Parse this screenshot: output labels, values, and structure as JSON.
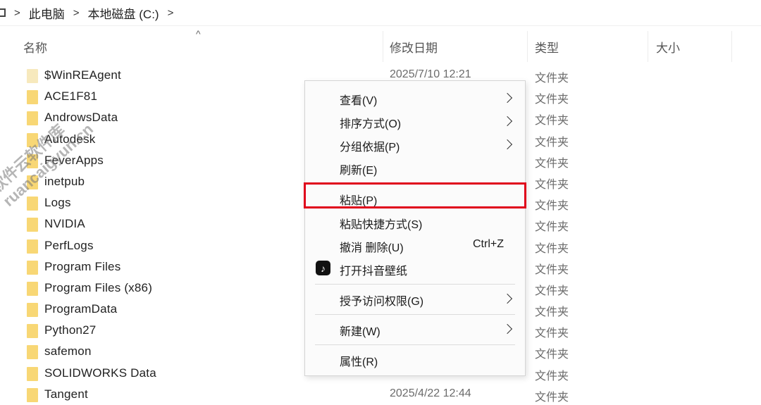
{
  "breadcrumb": {
    "items": [
      "此电脑",
      "本地磁盘 (C:)"
    ],
    "separator": ">"
  },
  "columns": {
    "name": "名称",
    "date": "修改日期",
    "type": "类型",
    "size": "大小",
    "sort_indicator": "^"
  },
  "rows": [
    {
      "name": "$WinREAgent",
      "date": "2025/7/10 12:21",
      "type": "文件夹",
      "icon": "folder-icon",
      "pale": true
    },
    {
      "name": "ACE1F81",
      "date": "",
      "type": "文件夹",
      "icon": "folder-icon"
    },
    {
      "name": "AndrowsData",
      "date": "",
      "type": "文件夹",
      "icon": "folder-icon"
    },
    {
      "name": "Autodesk",
      "date": "",
      "type": "文件夹",
      "icon": "folder-icon"
    },
    {
      "name": "FeverApps",
      "date": "",
      "type": "文件夹",
      "icon": "folder-icon"
    },
    {
      "name": "inetpub",
      "date": "",
      "type": "文件夹",
      "icon": "folder-icon"
    },
    {
      "name": "Logs",
      "date": "",
      "type": "文件夹",
      "icon": "folder-icon"
    },
    {
      "name": "NVIDIA",
      "date": "",
      "type": "文件夹",
      "icon": "folder-icon"
    },
    {
      "name": "PerfLogs",
      "date": "",
      "type": "文件夹",
      "icon": "folder-icon"
    },
    {
      "name": "Program Files",
      "date": "",
      "type": "文件夹",
      "icon": "folder-icon"
    },
    {
      "name": "Program Files (x86)",
      "date": "",
      "type": "文件夹",
      "icon": "folder-icon"
    },
    {
      "name": "ProgramData",
      "date": "",
      "type": "文件夹",
      "icon": "folder-icon"
    },
    {
      "name": "Python27",
      "date": "",
      "type": "文件夹",
      "icon": "folder-icon"
    },
    {
      "name": "safemon",
      "date": "",
      "type": "文件夹",
      "icon": "folder-icon"
    },
    {
      "name": "SOLIDWORKS Data",
      "date": "",
      "type": "文件夹",
      "icon": "folder-icon"
    },
    {
      "name": "Tangent",
      "date": "2025/4/22 12:44",
      "type": "文件夹",
      "icon": "folder-icon"
    }
  ],
  "context_menu": {
    "items": [
      {
        "label": "查看(V)",
        "submenu": true
      },
      {
        "label": "排序方式(O)",
        "submenu": true
      },
      {
        "label": "分组依据(P)",
        "submenu": true
      },
      {
        "label": "刷新(E)"
      },
      {
        "label": "粘贴(P)",
        "highlighted": true
      },
      {
        "label": "粘贴快捷方式(S)"
      },
      {
        "label": "撤消 删除(U)",
        "accelerator": "Ctrl+Z"
      },
      {
        "label": "打开抖音壁纸",
        "icon": "tiktok-icon"
      },
      {
        "label": "授予访问权限(G)",
        "submenu": true
      },
      {
        "label": "新建(W)",
        "submenu": true
      },
      {
        "label": "属性(R)"
      }
    ],
    "highlight_color": "#e0001b"
  },
  "watermark": {
    "line1": "软件云软件库",
    "line2": "ruancaigyun.cn"
  }
}
